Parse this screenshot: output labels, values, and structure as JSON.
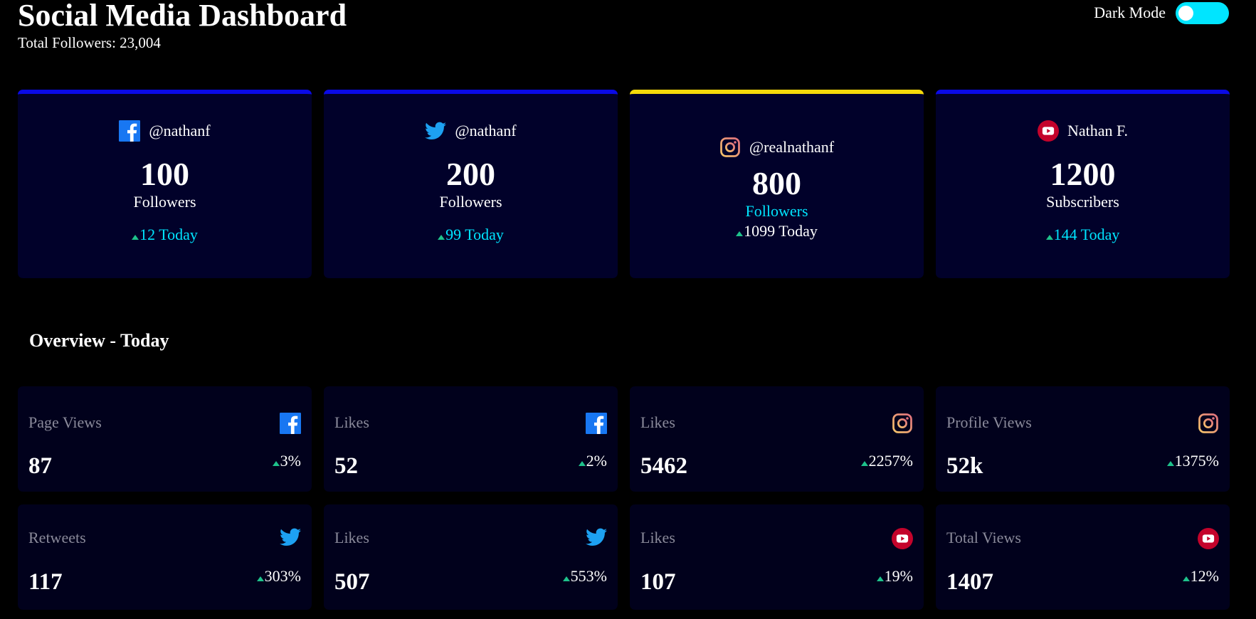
{
  "header": {
    "title": "Social Media Dashboard",
    "total_followers": "Total Followers: 23,004"
  },
  "toggle": {
    "label": "Dark Mode",
    "state": "on"
  },
  "colors": {
    "background": "#000000",
    "card_bg": "#01012a",
    "card_border": "#0a0ae6",
    "highlight_border": "#f5d90a",
    "accent": "#00e5ff",
    "up": "#1ec28b",
    "facebook": "#1877f2",
    "twitter": "#1da1f2",
    "instagram": "#e9a06a",
    "youtube": "#c4032b"
  },
  "cards": [
    {
      "platform": "facebook-icon",
      "handle": "@nathanf",
      "count": "100",
      "unit": "Followers",
      "today": "12 Today"
    },
    {
      "platform": "twitter-icon",
      "handle": "@nathanf",
      "count": "200",
      "unit": "Followers",
      "today": "99 Today"
    },
    {
      "platform": "instagram-icon",
      "handle": "@realnathanf",
      "count": "800",
      "unit": "Followers",
      "today": "1099 Today"
    },
    {
      "platform": "youtube-icon",
      "handle": "Nathan F.",
      "count": "1200",
      "unit": "Subscribers",
      "today": "144 Today"
    }
  ],
  "overview": {
    "title": "Overview - Today",
    "items": [
      {
        "label": "Page Views",
        "icon": "facebook-icon",
        "value": "87",
        "pct": "3%"
      },
      {
        "label": "Likes",
        "icon": "facebook-icon",
        "value": "52",
        "pct": "2%"
      },
      {
        "label": "Likes",
        "icon": "instagram-icon",
        "value": "5462",
        "pct": "2257%"
      },
      {
        "label": "Profile Views",
        "icon": "instagram-icon",
        "value": "52k",
        "pct": "1375%"
      },
      {
        "label": "Retweets",
        "icon": "twitter-icon",
        "value": "117",
        "pct": "303%"
      },
      {
        "label": "Likes",
        "icon": "twitter-icon",
        "value": "507",
        "pct": "553%"
      },
      {
        "label": "Likes",
        "icon": "youtube-icon",
        "value": "107",
        "pct": "19%"
      },
      {
        "label": "Total Views",
        "icon": "youtube-icon",
        "value": "1407",
        "pct": "12%"
      }
    ]
  }
}
